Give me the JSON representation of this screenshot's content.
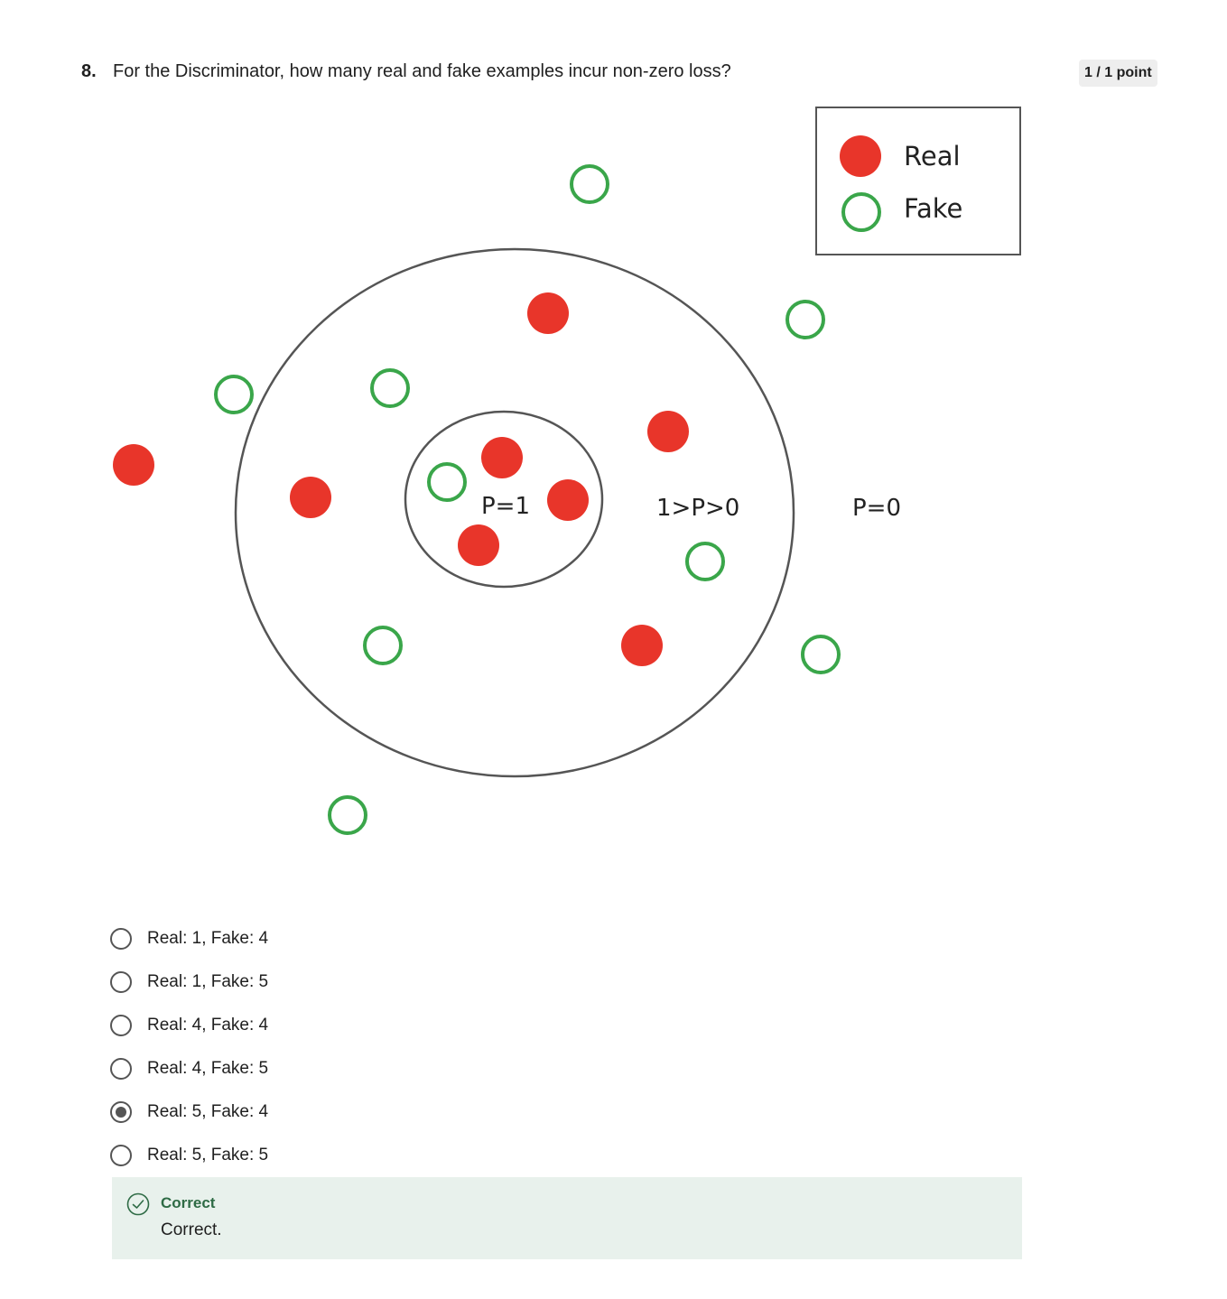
{
  "question": {
    "number": "8.",
    "text": "For the Discriminator, how many real and fake examples incur non-zero loss?",
    "points": "1 / 1 point"
  },
  "figure": {
    "legend": {
      "real": "Real",
      "fake": "Fake"
    },
    "regions": {
      "inner": "P=1",
      "middle": "1>P>0",
      "outer": "P=0"
    },
    "colors": {
      "real": "#e8352a",
      "fake": "#3aa64a",
      "outline": "#555555"
    }
  },
  "options": [
    {
      "label": "Real: 1, Fake: 4",
      "selected": false
    },
    {
      "label": "Real: 1, Fake: 5",
      "selected": false
    },
    {
      "label": "Real: 4, Fake: 4",
      "selected": false
    },
    {
      "label": "Real: 4, Fake: 5",
      "selected": false
    },
    {
      "label": "Real: 5, Fake: 4",
      "selected": true
    },
    {
      "label": "Real: 5, Fake: 5",
      "selected": false
    }
  ],
  "feedback": {
    "status": "Correct",
    "message": "Correct.",
    "icon": "check-circle-icon"
  }
}
